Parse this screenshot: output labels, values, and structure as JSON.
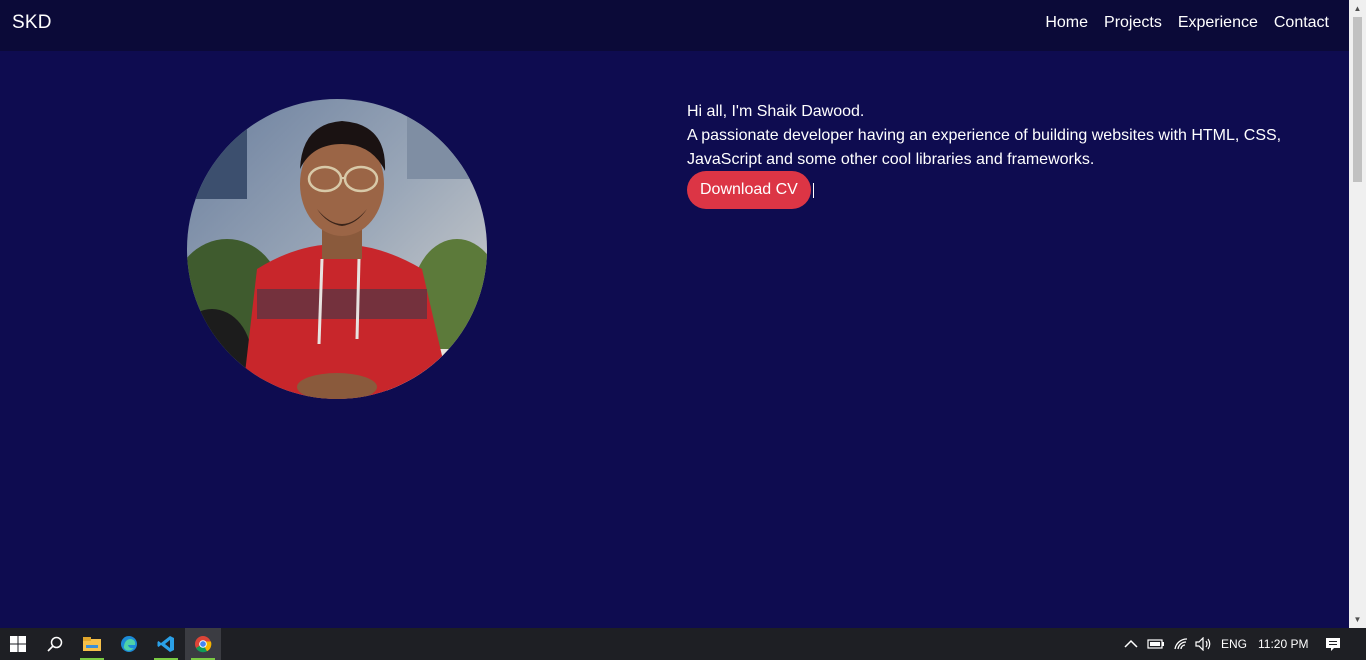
{
  "navbar": {
    "brand": "SKD",
    "links": [
      "Home",
      "Projects",
      "Experience",
      "Contact"
    ]
  },
  "hero": {
    "greeting": "Hi all, I'm Shaik Dawood.",
    "description": "A passionate developer having an experience of building websites with HTML, CSS, JavaScript and some other cool libraries and frameworks.",
    "download_label": "Download CV"
  },
  "taskbar": {
    "apps": [
      "windows-start-icon",
      "search-icon",
      "file-explorer-icon",
      "edge-icon",
      "vscode-icon",
      "chrome-icon"
    ],
    "language": "ENG",
    "time": "11:20 PM"
  },
  "colors": {
    "page_background": "#0e0c50",
    "navbar_background": "#0b0a38",
    "button": "#dc3545"
  }
}
